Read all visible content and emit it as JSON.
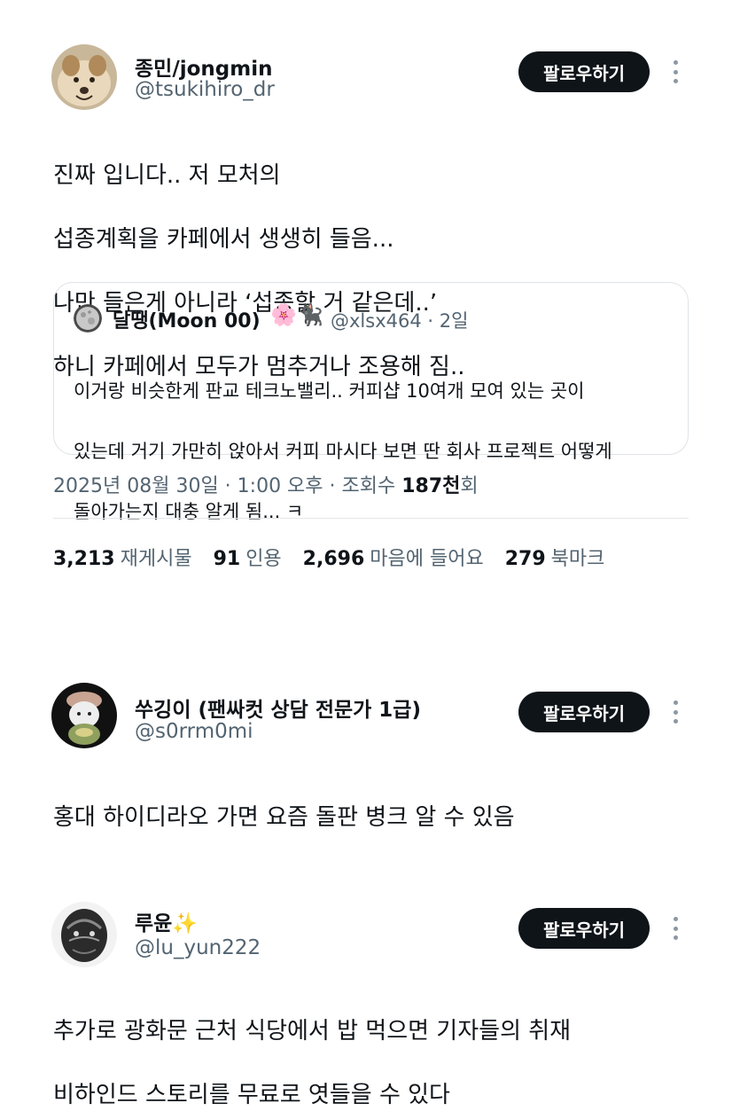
{
  "main_tweet": {
    "name": "종민/jongmin",
    "handle": "@tsukihiro_dr",
    "follow_label": "팔로우하기",
    "lines": [
      "진짜 입니다.. 저 모처의",
      "섭종계획을 카페에서 생생히 들음...",
      "나만 들은게 아니라 ‘섭종할 거 같은데..’",
      "하니 카페에서 모두가 멈추거나 조용해 짐.."
    ],
    "quote": {
      "name": "달땡(Moon 00)",
      "emoji_flower": "🌸",
      "emoji_cat": "🐈‍⬛",
      "meta": "@xlsx464 · 2일",
      "lines": [
        "이거랑 비슷한게 판교 테크노밸리.. 커피샵 10여개 모여 있는 곳이",
        "있는데 거기 가만히 앉아서 커피 마시다 보면 딴 회사 프로젝트 어떻게",
        "돌아가는지 대충 알게 됨... ㅋ"
      ]
    },
    "timestamp_prefix": "2025년 08월 30일 · 1:00 오후 · 조회수 ",
    "views_value": "187천",
    "views_suffix": "회",
    "stats": [
      {
        "value": "3,213",
        "label": "재게시물"
      },
      {
        "value": "91",
        "label": "인용"
      },
      {
        "value": "2,696",
        "label": "마음에 들어요"
      },
      {
        "value": "279",
        "label": "북마크"
      }
    ]
  },
  "replies": [
    {
      "name": "쑤깅이 (팬싸컷 상담 전문가 1급)",
      "handle": "@s0rrm0mi",
      "follow_label": "팔로우하기",
      "lines": [
        "홍대 하이디라오 가면 요즘 돌판 병크 알 수 있음"
      ]
    },
    {
      "name": "루윤",
      "name_emoji": "✨",
      "handle": "@lu_yun222",
      "follow_label": "팔로우하기",
      "lines": [
        "추가로 광화문 근처 식당에서 밥 먹으면 기자들의 취재",
        "비하인드 스토리를 무료로 엿들을 수 있다"
      ]
    }
  ]
}
